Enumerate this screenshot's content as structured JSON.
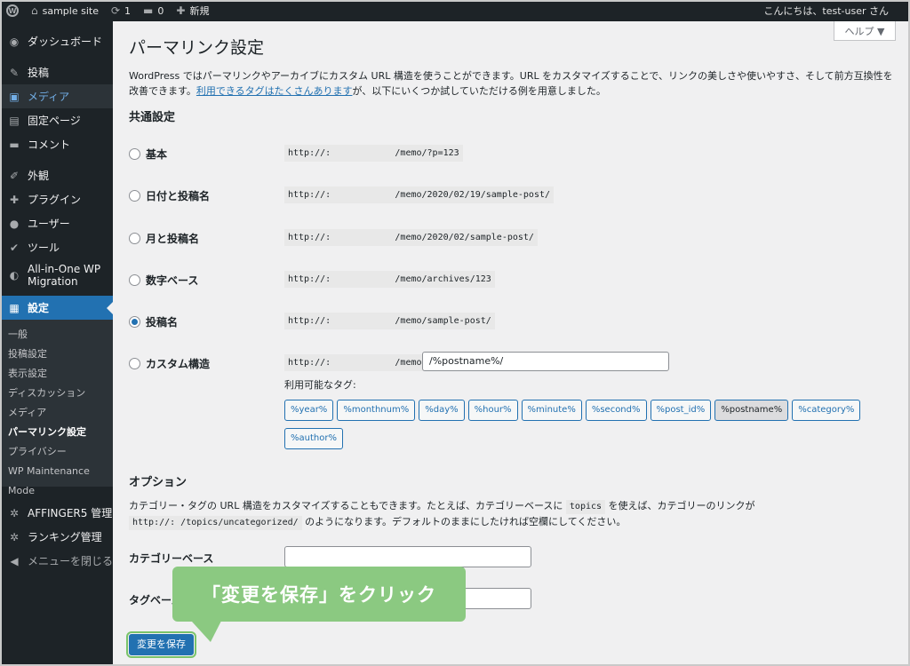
{
  "adminbar": {
    "site_name": "sample site",
    "updates_count": "1",
    "comments_count": "0",
    "new_label": "新規",
    "greeting": "こんにちは、test-user さん"
  },
  "sidebar": {
    "items": [
      {
        "label": "ダッシュボード",
        "icon": "dashboard-icon",
        "glyph": "◉"
      },
      {
        "label": "投稿",
        "icon": "pushpin-icon",
        "glyph": "✎"
      },
      {
        "label": "メディア",
        "icon": "media-icon",
        "glyph": "▣"
      },
      {
        "label": "固定ページ",
        "icon": "page-icon",
        "glyph": "▤"
      },
      {
        "label": "コメント",
        "icon": "comment-icon",
        "glyph": "▬"
      },
      {
        "label": "外観",
        "icon": "appearance-icon",
        "glyph": "✐"
      },
      {
        "label": "プラグイン",
        "icon": "plugin-icon",
        "glyph": "✚"
      },
      {
        "label": "ユーザー",
        "icon": "user-icon",
        "glyph": "●"
      },
      {
        "label": "ツール",
        "icon": "tools-icon",
        "glyph": "✔"
      },
      {
        "label": "All-in-One WP Migration",
        "icon": "migration-icon",
        "glyph": "◐"
      },
      {
        "label": "設定",
        "icon": "settings-icon",
        "glyph": "▦"
      }
    ],
    "submenu": [
      "一般",
      "投稿設定",
      "表示設定",
      "ディスカッション",
      "メディア",
      "パーマリンク設定",
      "プライバシー",
      "WP Maintenance Mode"
    ],
    "bottom_items": [
      {
        "label": "AFFINGER5 管理",
        "icon": "gear-icon",
        "glyph": "✲"
      },
      {
        "label": "ランキング管理",
        "icon": "gear-icon",
        "glyph": "✲"
      },
      {
        "label": "メニューを閉じる",
        "icon": "collapse-icon",
        "glyph": "◀"
      }
    ]
  },
  "help_label": "ヘルプ ▼",
  "page_title": "パーマリンク設定",
  "intro": {
    "text1": "WordPress ではパーマリンクやアーカイブにカスタム URL 構造を使うことができます。URL をカスタマイズすることで、リンクの美しさや使いやすさ、そして前方互換性を改善できます。",
    "link": "利用できるタグはたくさんあります",
    "text2": "が、以下にいくつか試していただける例を用意しました。"
  },
  "common_settings_heading": "共通設定",
  "permalink_options": [
    {
      "label": "基本",
      "example": "http://:            /memo/?p=123",
      "checked": false
    },
    {
      "label": "日付と投稿名",
      "example": "http://:            /memo/2020/02/19/sample-post/",
      "checked": false
    },
    {
      "label": "月と投稿名",
      "example": "http://:            /memo/2020/02/sample-post/",
      "checked": false
    },
    {
      "label": "数字ベース",
      "example": "http://:            /memo/archives/123",
      "checked": false
    },
    {
      "label": "投稿名",
      "example": "http://:            /memo/sample-post/",
      "checked": true
    },
    {
      "label": "カスタム構造",
      "example": "http://:            /memo",
      "checked": false
    }
  ],
  "custom_structure_value": "/%postname%/",
  "available_tags_label": "利用可能なタグ:",
  "tags": [
    "%year%",
    "%monthnum%",
    "%day%",
    "%hour%",
    "%minute%",
    "%second%",
    "%post_id%",
    "%postname%",
    "%category%",
    "%author%"
  ],
  "options": {
    "heading": "オプション",
    "desc1": "カテゴリー・タグの URL 構造をカスタマイズすることもできます。たとえば、カテゴリーベースに",
    "code_topics": "topics",
    "desc2": "を使えば、カテゴリーのリンクが",
    "code_url": "http://:                   /topics/uncategorized/",
    "desc3": "のようになります。デフォルトのままにしたければ空欄にしてください。",
    "category_base_label": "カテゴリーベース",
    "category_base_value": "",
    "tag_base_label": "タグベース",
    "tag_base_value": ""
  },
  "save_label": "変更を保存",
  "callout_text": "「変更を保存」をクリック"
}
